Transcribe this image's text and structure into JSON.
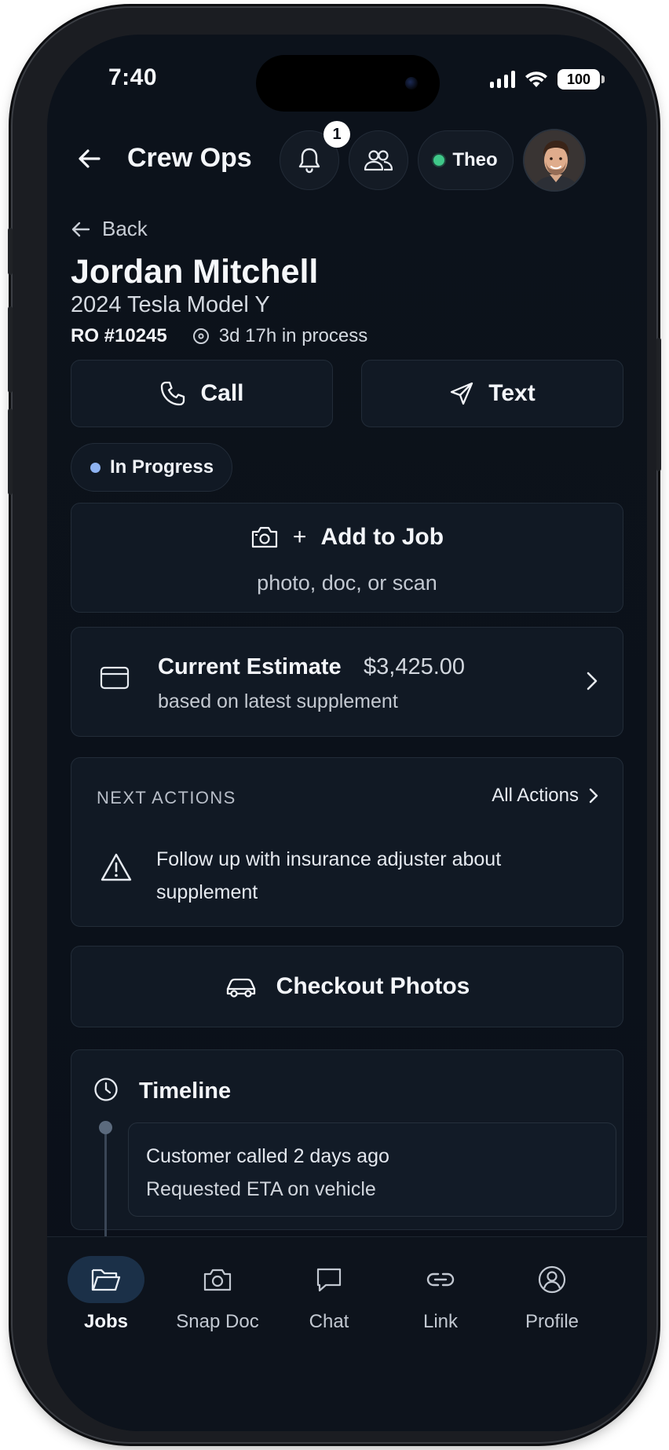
{
  "status_bar": {
    "time": "7:40",
    "battery": "100"
  },
  "header": {
    "title": "Crew Ops",
    "notification_count": "1",
    "user_name": "Theo"
  },
  "back_link": {
    "label": "Back"
  },
  "customer": {
    "name": "Jordan Mitchell",
    "vehicle": "2024 Tesla Model Y",
    "ro_number": "RO #10245",
    "time_in_process": "3d 17h in process"
  },
  "actions": {
    "call_label": "Call",
    "text_label": "Text"
  },
  "status": {
    "label": "In Progress",
    "color": "#8eb3f2"
  },
  "add_to_job": {
    "title": "Add to Job",
    "subtitle": "photo, doc, or scan"
  },
  "estimate": {
    "label": "Current Estimate",
    "amount": "$3,425.00",
    "subtitle": "based on latest supplement"
  },
  "next_actions": {
    "heading": "NEXT ACTIONS",
    "all_label": "All Actions",
    "items": [
      {
        "text": "Follow up with insurance adjuster about supplement",
        "icon": "warning-icon"
      }
    ]
  },
  "checkout": {
    "label": "Checkout Photos"
  },
  "timeline": {
    "title": "Timeline",
    "entries": [
      {
        "line1": "Customer called 2 days ago",
        "line2": "Requested ETA on vehicle"
      }
    ]
  },
  "bottom_nav": {
    "items": [
      {
        "label": "Jobs",
        "icon": "folder-icon",
        "active": true
      },
      {
        "label": "Snap Doc",
        "icon": "camera-icon",
        "active": false
      },
      {
        "label": "Chat",
        "icon": "chat-icon",
        "active": false
      },
      {
        "label": "Link",
        "icon": "link-icon",
        "active": false
      },
      {
        "label": "Profile",
        "icon": "user-circle-icon",
        "active": false
      }
    ]
  },
  "colors": {
    "background": "#0b111a",
    "card": "#111924",
    "online": "#3fc889",
    "accent": "#1b3048"
  }
}
